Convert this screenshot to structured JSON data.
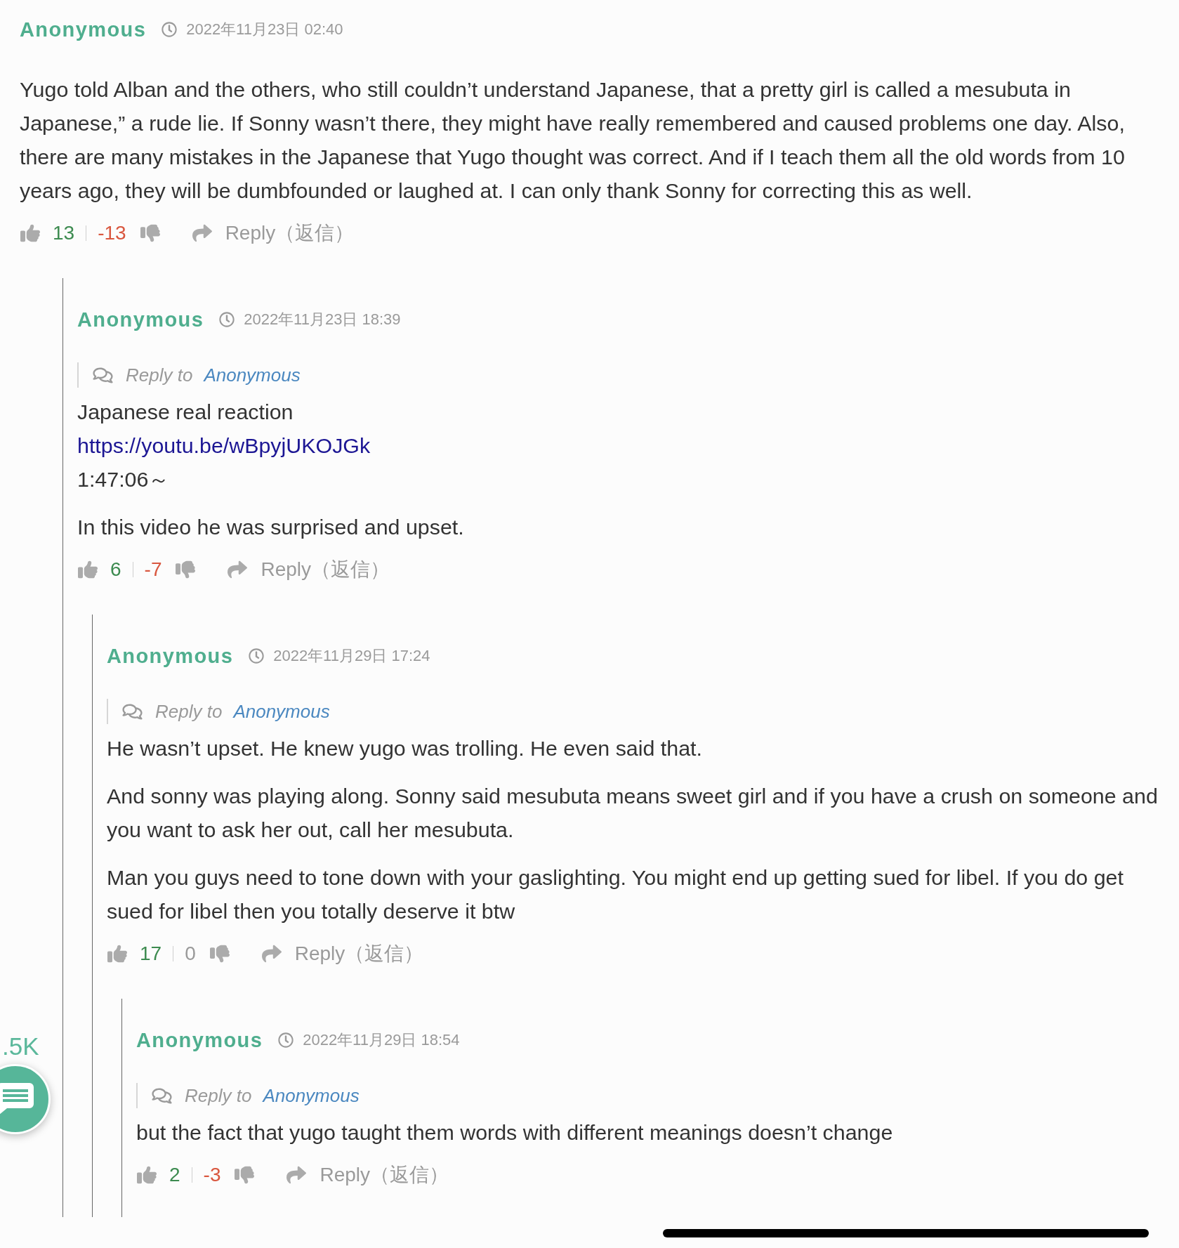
{
  "thread": [
    {
      "author": "Anonymous",
      "date": "2022年11月23日 02:40",
      "paragraphs": [
        {
          "lines": [
            {
              "kind": "text",
              "text": "Yugo told Alban and the others, who still couldn’t understand Japanese, that a pretty girl is called a mesubuta in Japanese,” a rude lie. If Sonny wasn’t there, they might have really remembered and caused problems one day. Also, there are many mistakes in the Japanese that Yugo thought was correct. And if I teach them all the old words from 10 years ago, they will be dumbfounded or laughed at. I can only thank Sonny for correcting this as well."
            }
          ]
        }
      ],
      "likes": "13",
      "dislikes": "-13",
      "dislikes_negative": true,
      "reply_label": "Reply（返信）",
      "children": [
        {
          "author": "Anonymous",
          "date": "2022年11月23日 18:39",
          "reply_to": {
            "label": "Reply to",
            "name": "Anonymous"
          },
          "paragraphs": [
            {
              "lines": [
                {
                  "kind": "text",
                  "text": "Japanese real reaction"
                },
                {
                  "kind": "link",
                  "text": "https://youtu.be/wBpyjUKOJGk"
                },
                {
                  "kind": "text",
                  "text": "1:47:06～"
                }
              ]
            },
            {
              "lines": [
                {
                  "kind": "text",
                  "text": "In this video he was surprised and upset."
                }
              ]
            }
          ],
          "likes": "6",
          "dislikes": "-7",
          "dislikes_negative": true,
          "reply_label": "Reply（返信）",
          "children": [
            {
              "author": "Anonymous",
              "date": "2022年11月29日 17:24",
              "reply_to": {
                "label": "Reply to",
                "name": "Anonymous"
              },
              "paragraphs": [
                {
                  "lines": [
                    {
                      "kind": "text",
                      "text": "He wasn’t upset. He knew yugo was trolling. He even said that."
                    }
                  ]
                },
                {
                  "lines": [
                    {
                      "kind": "text",
                      "text": "And sonny was playing along. Sonny said mesubuta means sweet girl and if you have a crush on someone and you want to ask her out, call her mesubuta."
                    }
                  ]
                },
                {
                  "lines": [
                    {
                      "kind": "text",
                      "text": "Man you guys need to tone down with your gaslighting. You might end up getting sued for libel. If you do get sued for libel then you totally deserve it btw"
                    }
                  ]
                }
              ],
              "likes": "17",
              "dislikes": "0",
              "dislikes_negative": false,
              "reply_label": "Reply（返信）",
              "children": [
                {
                  "author": "Anonymous",
                  "date": "2022年11月29日 18:54",
                  "reply_to": {
                    "label": "Reply to",
                    "name": "Anonymous"
                  },
                  "paragraphs": [
                    {
                      "lines": [
                        {
                          "kind": "text",
                          "text": "but the fact that yugo taught them words with different meanings doesn’t change"
                        }
                      ]
                    }
                  ],
                  "likes": "2",
                  "dislikes": "-3",
                  "dislikes_negative": true,
                  "reply_label": "Reply（返信）"
                }
              ]
            }
          ]
        }
      ]
    }
  ],
  "comments_button": {
    "count": ".5K"
  }
}
